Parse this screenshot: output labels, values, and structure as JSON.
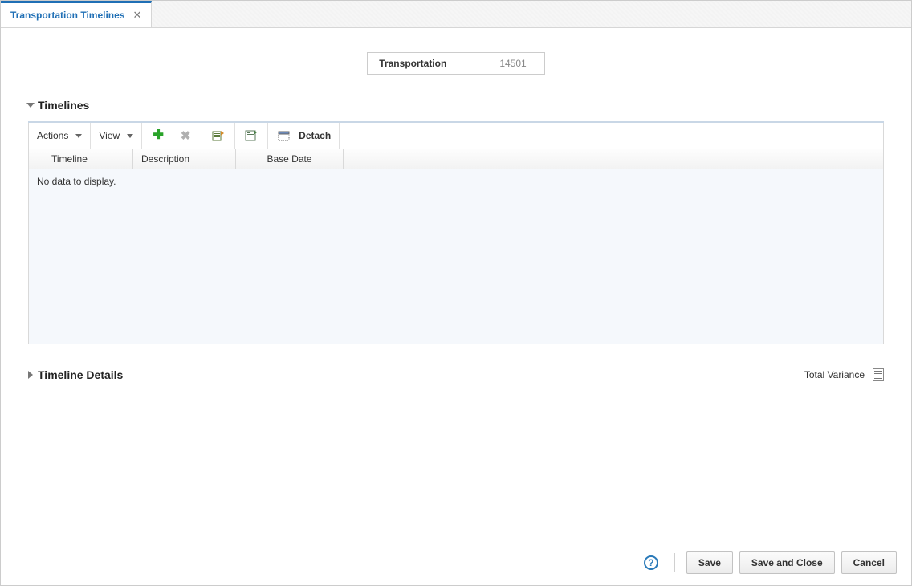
{
  "tab": {
    "label": "Transportation Timelines"
  },
  "header": {
    "label": "Transportation",
    "value": "14501"
  },
  "sections": {
    "timelines": {
      "title": "Timelines"
    },
    "details": {
      "title": "Timeline Details"
    }
  },
  "toolbar": {
    "actions_label": "Actions",
    "view_label": "View",
    "detach_label": "Detach"
  },
  "grid": {
    "columns": {
      "timeline": "Timeline",
      "description": "Description",
      "base_date": "Base Date"
    },
    "no_data": "No data to display."
  },
  "variance": {
    "label": "Total Variance"
  },
  "buttons": {
    "save": "Save",
    "save_close": "Save and Close",
    "cancel": "Cancel"
  }
}
